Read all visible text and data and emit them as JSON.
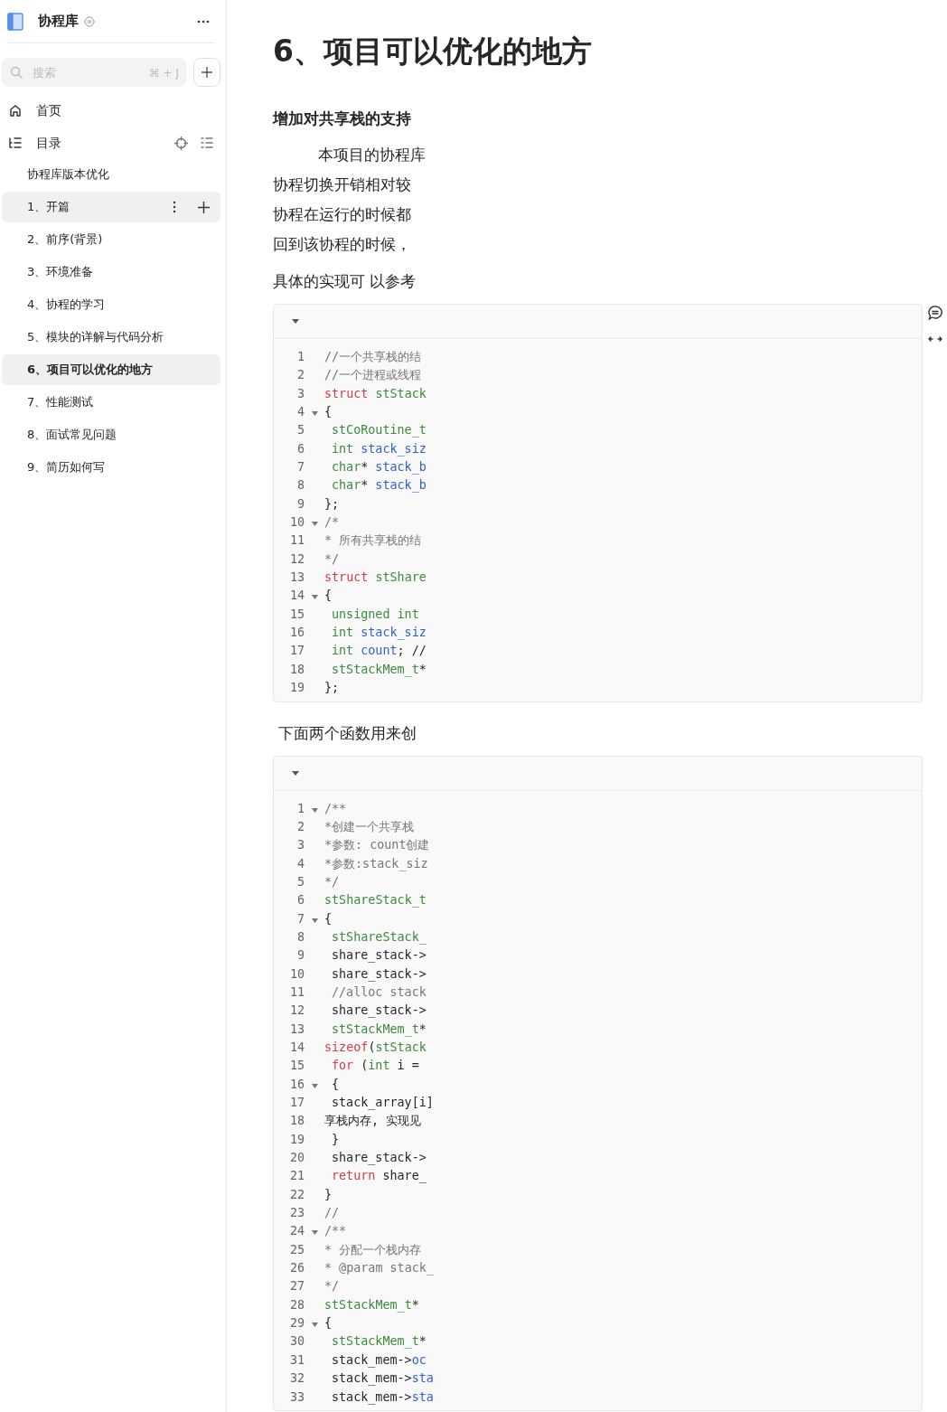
{
  "sidebar": {
    "title": "协程库",
    "search": {
      "placeholder": "搜索",
      "shortcut": "⌘ + J"
    },
    "nav": [
      {
        "kind": "home",
        "label": "首页"
      },
      {
        "kind": "toc",
        "label": "目录"
      }
    ],
    "tree": [
      {
        "label": "协程库版本优化",
        "selected": false,
        "hovered": false
      },
      {
        "label": "1、开篇",
        "selected": false,
        "hovered": true
      },
      {
        "label": "2、前序(背景)",
        "selected": false,
        "hovered": false
      },
      {
        "label": "3、环境准备",
        "selected": false,
        "hovered": false
      },
      {
        "label": "4、协程的学习",
        "selected": false,
        "hovered": false
      },
      {
        "label": "5、模块的详解与代码分析",
        "selected": false,
        "hovered": false
      },
      {
        "label": "6、项目可以优化的地方",
        "selected": true,
        "hovered": false
      },
      {
        "label": "7、性能测试",
        "selected": false,
        "hovered": false
      },
      {
        "label": "8、面试常见问题",
        "selected": false,
        "hovered": false
      },
      {
        "label": "9、简历如何写",
        "selected": false,
        "hovered": false
      }
    ]
  },
  "document": {
    "title": "6、项目可以优化的地方",
    "blocks": [
      {
        "kind": "heading",
        "text": "增加对共享栈的支持"
      },
      {
        "kind": "paragraph",
        "lines": [
          "本项目的协程库",
          "协程切换开销相对较",
          "协程在运行的时候都",
          "回到该协程的时候，"
        ]
      },
      {
        "kind": "paragraph",
        "lines": [
          "具体的实现可 以参考"
        ]
      },
      {
        "kind": "code",
        "lines": [
          {
            "number": "1",
            "fold": false,
            "indent": false,
            "tokens": [
              {
                "text": "//一个共享栈的结",
                "kind": "comment"
              }
            ]
          },
          {
            "number": "2",
            "fold": false,
            "indent": false,
            "tokens": [
              {
                "text": "//一个进程或线程",
                "kind": "comment"
              }
            ]
          },
          {
            "number": "3",
            "fold": false,
            "indent": false,
            "tokens": [
              {
                "text": "struct ",
                "kind": "keyword"
              },
              {
                "text": "stStack",
                "kind": "type"
              }
            ]
          },
          {
            "number": "4",
            "fold": true,
            "indent": false,
            "tokens": [
              {
                "text": "{",
                "kind": "plain"
              }
            ]
          },
          {
            "number": "5",
            "fold": false,
            "indent": true,
            "tokens": [
              {
                "text": "stCoRoutine_t",
                "kind": "type"
              }
            ]
          },
          {
            "number": "6",
            "fold": false,
            "indent": true,
            "tokens": [
              {
                "text": "int",
                "kind": "type"
              },
              {
                "text": " stack_siz",
                "kind": "name"
              }
            ]
          },
          {
            "number": "7",
            "fold": false,
            "indent": true,
            "tokens": [
              {
                "text": "char",
                "kind": "type"
              },
              {
                "text": "*",
                "kind": "plain"
              },
              {
                "text": " stack_b",
                "kind": "name"
              }
            ]
          },
          {
            "number": "8",
            "fold": false,
            "indent": true,
            "tokens": [
              {
                "text": "char",
                "kind": "type"
              },
              {
                "text": "*",
                "kind": "plain"
              },
              {
                "text": " stack_b",
                "kind": "name"
              }
            ]
          },
          {
            "number": "9",
            "fold": false,
            "indent": false,
            "tokens": [
              {
                "text": "};",
                "kind": "plain"
              }
            ]
          },
          {
            "number": "10",
            "fold": true,
            "indent": false,
            "tokens": [
              {
                "text": "/*",
                "kind": "comment"
              }
            ]
          },
          {
            "number": "11",
            "fold": false,
            "indent": false,
            "tokens": [
              {
                "text": "* 所有共享栈的结",
                "kind": "comment"
              }
            ]
          },
          {
            "number": "12",
            "fold": false,
            "indent": false,
            "tokens": [
              {
                "text": "*/",
                "kind": "comment"
              }
            ]
          },
          {
            "number": "13",
            "fold": false,
            "indent": false,
            "tokens": [
              {
                "text": "struct ",
                "kind": "keyword"
              },
              {
                "text": "stShare",
                "kind": "type"
              }
            ]
          },
          {
            "number": "14",
            "fold": true,
            "indent": false,
            "tokens": [
              {
                "text": "{",
                "kind": "plain"
              }
            ]
          },
          {
            "number": "15",
            "fold": false,
            "indent": true,
            "tokens": [
              {
                "text": "unsigned int",
                "kind": "type"
              }
            ]
          },
          {
            "number": "16",
            "fold": false,
            "indent": true,
            "tokens": [
              {
                "text": "int",
                "kind": "type"
              },
              {
                "text": " stack_siz",
                "kind": "name"
              }
            ]
          },
          {
            "number": "17",
            "fold": false,
            "indent": true,
            "tokens": [
              {
                "text": "int",
                "kind": "type"
              },
              {
                "text": " count",
                "kind": "name"
              },
              {
                "text": "; //",
                "kind": "plain"
              }
            ]
          },
          {
            "number": "18",
            "fold": false,
            "indent": true,
            "tokens": [
              {
                "text": "stStackMem_t",
                "kind": "type"
              },
              {
                "text": "*",
                "kind": "plain"
              }
            ]
          },
          {
            "number": "19",
            "fold": false,
            "indent": false,
            "tokens": [
              {
                "text": "};",
                "kind": "plain"
              }
            ]
          }
        ]
      },
      {
        "kind": "paragraph",
        "lines": [
          "下面两个函数用来创"
        ]
      },
      {
        "kind": "code",
        "lines": [
          {
            "number": "1",
            "fold": true,
            "indent": false,
            "tokens": [
              {
                "text": "/**",
                "kind": "comment"
              }
            ]
          },
          {
            "number": "2",
            "fold": false,
            "indent": false,
            "tokens": [
              {
                "text": "*创建一个共享栈",
                "kind": "comment"
              }
            ]
          },
          {
            "number": "3",
            "fold": false,
            "indent": false,
            "tokens": [
              {
                "text": "*参数: count创建",
                "kind": "comment"
              }
            ]
          },
          {
            "number": "4",
            "fold": false,
            "indent": false,
            "tokens": [
              {
                "text": "*参数:stack_siz",
                "kind": "comment"
              }
            ]
          },
          {
            "number": "5",
            "fold": false,
            "indent": false,
            "tokens": [
              {
                "text": "*/",
                "kind": "comment"
              }
            ]
          },
          {
            "number": "6",
            "fold": false,
            "indent": false,
            "tokens": [
              {
                "text": "stShareStack_t",
                "kind": "type"
              }
            ]
          },
          {
            "number": "7",
            "fold": true,
            "indent": false,
            "tokens": [
              {
                "text": "{",
                "kind": "plain"
              }
            ]
          },
          {
            "number": "8",
            "fold": false,
            "indent": true,
            "tokens": [
              {
                "text": "stShareStack_",
                "kind": "type"
              }
            ]
          },
          {
            "number": "9",
            "fold": false,
            "indent": true,
            "tokens": [
              {
                "text": "share_stack->",
                "kind": "plain"
              }
            ]
          },
          {
            "number": "10",
            "fold": false,
            "indent": true,
            "tokens": [
              {
                "text": "share_stack->",
                "kind": "plain"
              }
            ]
          },
          {
            "number": "11",
            "fold": false,
            "indent": true,
            "tokens": [
              {
                "text": "//alloc stack",
                "kind": "comment"
              }
            ]
          },
          {
            "number": "12",
            "fold": false,
            "indent": true,
            "tokens": [
              {
                "text": "share_stack->",
                "kind": "plain"
              }
            ]
          },
          {
            "number": "13",
            "fold": false,
            "indent": true,
            "tokens": [
              {
                "text": "stStackMem_t",
                "kind": "type"
              },
              {
                "text": "*",
                "kind": "plain"
              }
            ]
          },
          {
            "number": "14",
            "fold": false,
            "indent": false,
            "tokens": [
              {
                "text": "sizeof",
                "kind": "keyword"
              },
              {
                "text": "(",
                "kind": "plain"
              },
              {
                "text": "stStack",
                "kind": "type"
              }
            ]
          },
          {
            "number": "15",
            "fold": false,
            "indent": true,
            "tokens": [
              {
                "text": "for",
                "kind": "keyword"
              },
              {
                "text": " (",
                "kind": "plain"
              },
              {
                "text": "int",
                "kind": "type"
              },
              {
                "text": " i =",
                "kind": "plain"
              }
            ]
          },
          {
            "number": "16",
            "fold": true,
            "indent": true,
            "tokens": [
              {
                "text": "{",
                "kind": "plain"
              }
            ]
          },
          {
            "number": "17",
            "fold": false,
            "indent": true,
            "tokens": [
              {
                "text": "stack_array[i]",
                "kind": "plain"
              }
            ]
          },
          {
            "number": "18",
            "fold": false,
            "indent": false,
            "tokens": [
              {
                "text": "享栈内存, 实现见",
                "kind": "plain"
              }
            ]
          },
          {
            "number": "19",
            "fold": false,
            "indent": true,
            "tokens": [
              {
                "text": "}",
                "kind": "plain"
              }
            ]
          },
          {
            "number": "20",
            "fold": false,
            "indent": true,
            "tokens": [
              {
                "text": "share_stack->",
                "kind": "plain"
              }
            ]
          },
          {
            "number": "21",
            "fold": false,
            "indent": true,
            "tokens": [
              {
                "text": "return",
                "kind": "keyword"
              },
              {
                "text": " share_",
                "kind": "plain"
              }
            ]
          },
          {
            "number": "22",
            "fold": false,
            "indent": false,
            "tokens": [
              {
                "text": "}",
                "kind": "plain"
              }
            ]
          },
          {
            "number": "23",
            "fold": false,
            "indent": false,
            "tokens": [
              {
                "text": "//",
                "kind": "comment"
              }
            ]
          },
          {
            "number": "24",
            "fold": true,
            "indent": false,
            "tokens": [
              {
                "text": "/**",
                "kind": "comment"
              }
            ]
          },
          {
            "number": "25",
            "fold": false,
            "indent": false,
            "tokens": [
              {
                "text": "* 分配一个栈内存",
                "kind": "comment"
              }
            ]
          },
          {
            "number": "26",
            "fold": false,
            "indent": false,
            "tokens": [
              {
                "text": "* @param stack_",
                "kind": "comment"
              }
            ]
          },
          {
            "number": "27",
            "fold": false,
            "indent": false,
            "tokens": [
              {
                "text": "*/",
                "kind": "comment"
              }
            ]
          },
          {
            "number": "28",
            "fold": false,
            "indent": false,
            "tokens": [
              {
                "text": "stStackMem_t",
                "kind": "type"
              },
              {
                "text": "*",
                "kind": "plain"
              }
            ]
          },
          {
            "number": "29",
            "fold": true,
            "indent": false,
            "tokens": [
              {
                "text": "{",
                "kind": "plain"
              }
            ]
          },
          {
            "number": "30",
            "fold": false,
            "indent": true,
            "tokens": [
              {
                "text": "stStackMem_t",
                "kind": "type"
              },
              {
                "text": "*",
                "kind": "plain"
              }
            ]
          },
          {
            "number": "31",
            "fold": false,
            "indent": true,
            "tokens": [
              {
                "text": "stack_mem->",
                "kind": "plain"
              },
              {
                "text": "oc",
                "kind": "name"
              }
            ]
          },
          {
            "number": "32",
            "fold": false,
            "indent": true,
            "tokens": [
              {
                "text": "stack_mem->",
                "kind": "plain"
              },
              {
                "text": "sta",
                "kind": "name"
              }
            ]
          },
          {
            "number": "33",
            "fold": false,
            "indent": true,
            "tokens": [
              {
                "text": "stack_mem->",
                "kind": "plain"
              },
              {
                "text": "sta",
                "kind": "name"
              }
            ]
          }
        ]
      }
    ]
  }
}
